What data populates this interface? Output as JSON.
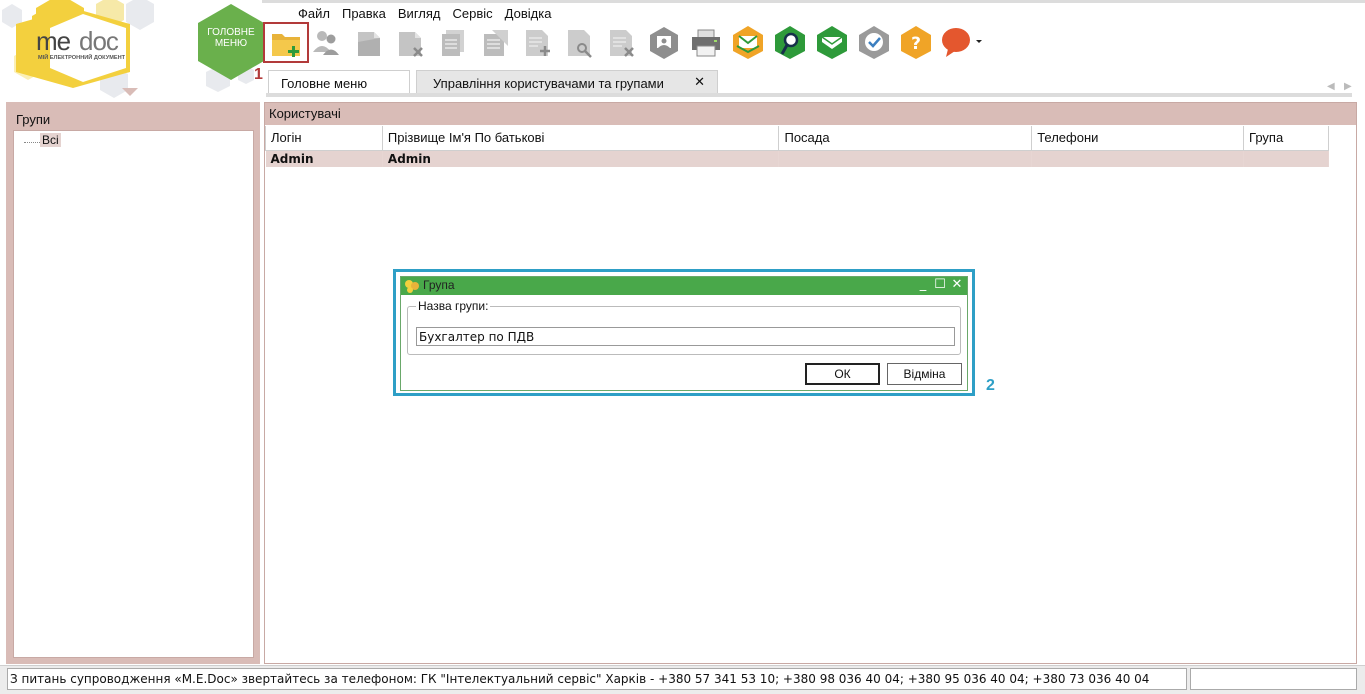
{
  "header": {
    "logo_me": "me",
    "logo_doc": "doc",
    "logo_subtitle": "МІЙ ЕЛЕКТРОННИЙ ДОКУМЕНТ",
    "home_button_label": "ГОЛОВНЕ\nМЕНЮ",
    "brand_yellow": "#f3d03e",
    "brand_green": "#6ab04c"
  },
  "menu": {
    "items": [
      {
        "label": "Файл"
      },
      {
        "label": "Правка"
      },
      {
        "label": "Вигляд"
      },
      {
        "label": "Сервіс"
      },
      {
        "label": "Довідка"
      }
    ]
  },
  "toolbar": {
    "buttons": [
      {
        "icon": "new-folder-add-icon",
        "enabled": true
      },
      {
        "icon": "users-properties-icon",
        "enabled": false
      },
      {
        "icon": "open-document-icon",
        "enabled": false
      },
      {
        "icon": "delete-document-icon",
        "enabled": false
      },
      {
        "icon": "copy-documents-icon",
        "enabled": false
      },
      {
        "icon": "edit-document-icon",
        "enabled": false
      },
      {
        "icon": "add-document-icon",
        "enabled": false
      },
      {
        "icon": "search-document-icon",
        "enabled": false
      },
      {
        "icon": "remove-document-icon",
        "enabled": false
      },
      {
        "icon": "view-photo-icon",
        "enabled": false
      },
      {
        "icon": "printer-icon",
        "enabled": true
      },
      {
        "icon": "envelope-send-icon",
        "enabled": true
      },
      {
        "icon": "search-green-icon",
        "enabled": true
      },
      {
        "icon": "envelope-receive-icon",
        "enabled": true
      },
      {
        "icon": "check-status-icon",
        "enabled": false
      },
      {
        "icon": "help-icon",
        "enabled": true
      },
      {
        "icon": "chat-bubble-icon",
        "enabled": true
      }
    ]
  },
  "annotations": {
    "step1": "1",
    "step2": "2"
  },
  "tabs": {
    "home_label": "Головне меню",
    "users_label": "Управління користувачами та групами",
    "close_glyph": "✕",
    "scroll_left": "◀",
    "scroll_right": "▶"
  },
  "groups_panel": {
    "title": "Групи",
    "tree": [
      {
        "label": "Всі",
        "selected": true
      }
    ]
  },
  "users_panel": {
    "title": "Користувачі",
    "columns": [
      "Логін",
      "Прізвище Ім'я По батькові",
      "Посада",
      "Телефони",
      "Група"
    ],
    "rows": [
      {
        "login": "Admin",
        "full_name": "Admin",
        "position": "",
        "phones": "",
        "group": ""
      }
    ]
  },
  "dialog": {
    "title": "Група",
    "field_label": "Назва групи:",
    "field_value": "Бухгалтер по ПДВ",
    "ok_label": "ОК",
    "cancel_label": "Відміна",
    "minimize_glyph": "_",
    "maximize_glyph": "☐",
    "close_glyph": "✕"
  },
  "status_bar": {
    "text": "З питань супроводження «M.E.Doc» звертайтесь за телефоном: ГК \"Інтелектуальний сервіс\" Харків - +380 57 341 53 10; +380 98 036 40 04; +380 95 036 40 04; +380 73 036 40 04"
  }
}
